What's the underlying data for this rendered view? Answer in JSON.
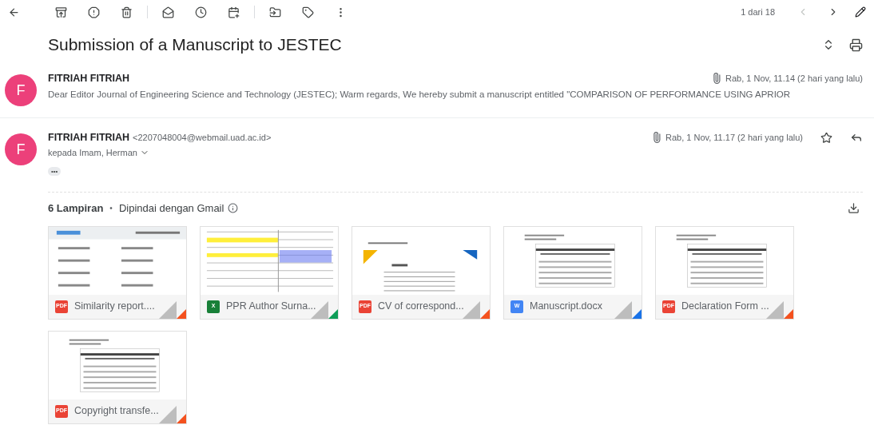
{
  "toolbar": {
    "pager": "1 dari 18"
  },
  "subject": "Submission of a Manuscript to JESTEC",
  "messages": [
    {
      "kind": "collapsed",
      "sender": "FITRIAH FITRIAH",
      "avatar": "F",
      "date": "Rab, 1 Nov, 11.14 (2 hari yang lalu)",
      "has_attachment": true,
      "snippet": "Dear Editor Journal of Engineering Science and Technology (JESTEC); Warm regards, We hereby submit a manuscript entitled \"COMPARISON OF PERFORMANCE USING APRIOR"
    },
    {
      "kind": "expanded",
      "sender": "FITRIAH FITRIAH",
      "avatar": "F",
      "email": "<2207048004@webmail.uad.ac.id>",
      "date": "Rab, 1 Nov, 11.17 (2 hari yang lalu)",
      "has_attachment": true,
      "starred": false,
      "recipients": "kepada Imam, Herman",
      "trimmed": "•••"
    }
  ],
  "attachments_header": {
    "count": "6 Lampiran",
    "separator": "•",
    "scan": "Dipindai dengan Gmail"
  },
  "attachments": [
    {
      "name": "Similarity report....",
      "kind": "pdf",
      "badge": "PDF"
    },
    {
      "name": "PPR Author Surna...",
      "kind": "xlsx",
      "badge": "X"
    },
    {
      "name": "CV of correspond...",
      "kind": "pdf",
      "badge": "PDF"
    },
    {
      "name": "Manuscript.docx",
      "kind": "docx",
      "badge": "W"
    },
    {
      "name": "Declaration Form ...",
      "kind": "pdf",
      "badge": "PDF"
    },
    {
      "name": "Copyright transfe...",
      "kind": "pdf",
      "badge": "PDF"
    }
  ]
}
